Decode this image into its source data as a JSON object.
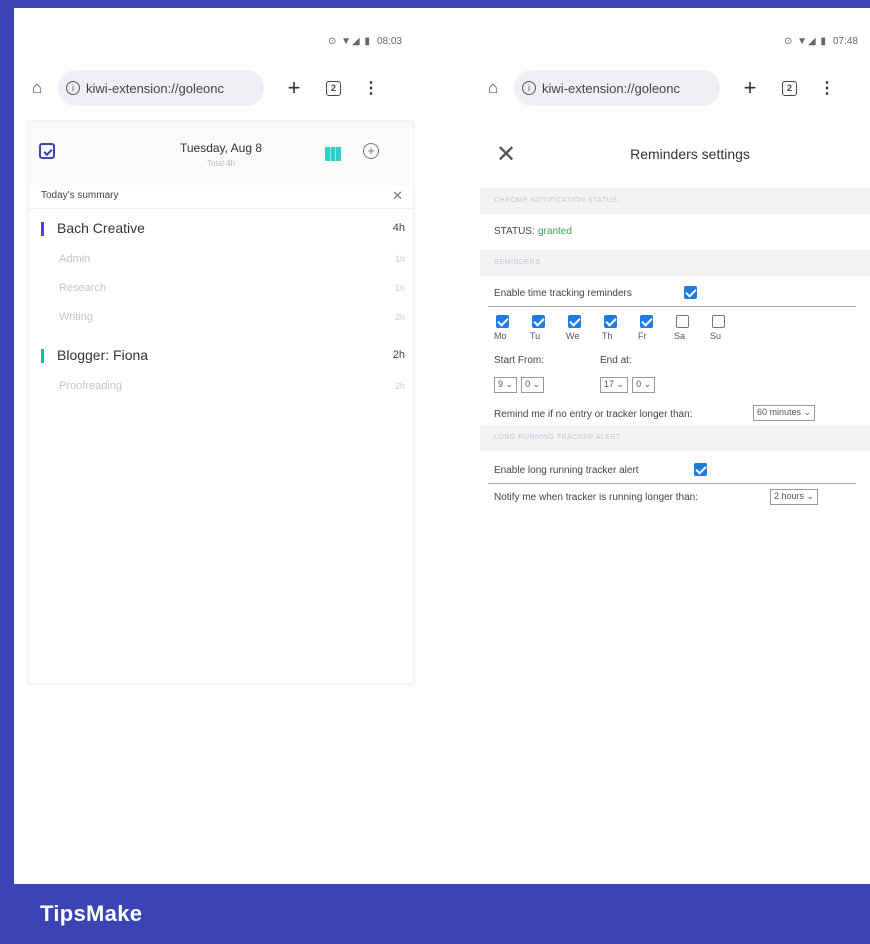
{
  "left": {
    "status_time": "08:03",
    "url": "kiwi-extension://goleonc",
    "tab_count": "2",
    "date": "Tuesday, Aug 8",
    "total": "Total 4h",
    "summary_title": "Today's summary",
    "projects": [
      {
        "name": "Bach Creative",
        "hours": "4h",
        "color": "#5b3ec9",
        "tasks": [
          {
            "name": "Admin",
            "hours": "1h"
          },
          {
            "name": "Research",
            "hours": "1h"
          },
          {
            "name": "Writing",
            "hours": "2h"
          }
        ]
      },
      {
        "name": "Blogger: Fiona",
        "hours": "2h",
        "color": "#1fb59b",
        "tasks": [
          {
            "name": "Proofreading",
            "hours": "2h"
          }
        ]
      }
    ]
  },
  "right": {
    "status_time": "07:48",
    "url": "kiwi-extension://goleonc",
    "tab_count": "2",
    "title": "Reminders settings",
    "section_notification": "Chrome notification status",
    "status_label": "STATUS:",
    "status_value": "granted",
    "section_reminders": "Reminders",
    "enable_reminders_label": "Enable time tracking reminders",
    "days": [
      {
        "label": "Mo",
        "checked": true
      },
      {
        "label": "Tu",
        "checked": true
      },
      {
        "label": "We",
        "checked": true
      },
      {
        "label": "Th",
        "checked": true
      },
      {
        "label": "Fr",
        "checked": true
      },
      {
        "label": "Sa",
        "checked": false
      },
      {
        "label": "Su",
        "checked": false
      }
    ],
    "start_from_label": "Start From:",
    "end_at_label": "End at:",
    "start_hour": "9",
    "start_minute": "0",
    "end_hour": "17",
    "end_minute": "0",
    "remind_label": "Remind me if no entry or tracker longer than:",
    "remind_value": "60 minutes",
    "section_long_running": "Long running tracker alert",
    "enable_alert_label": "Enable long running tracker alert",
    "notify_label": "Notify me when tracker is running longer than:",
    "notify_value": "2 hours"
  },
  "footer": {
    "brand": "TipsMake"
  },
  "colors": {
    "brand": "#3a44b5",
    "accent": "#1e7be0",
    "granted": "#3aa54a"
  }
}
